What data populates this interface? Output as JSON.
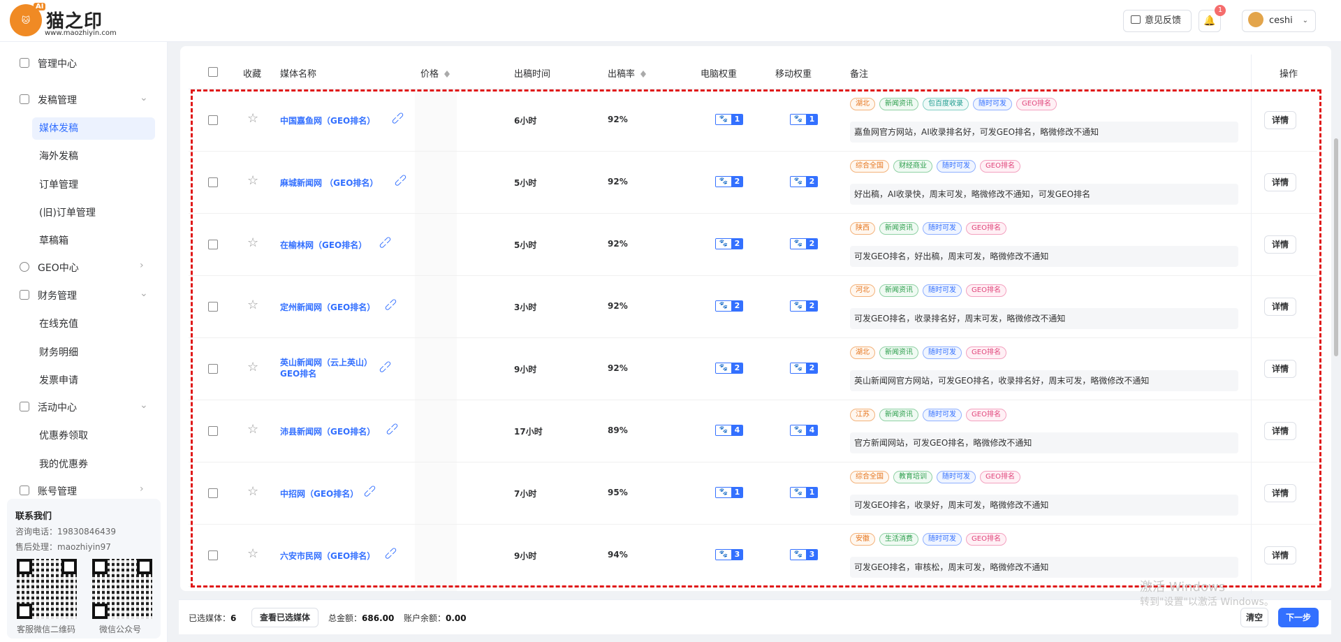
{
  "brand": {
    "title": "猫之印",
    "url": "www.maozhiyin.com",
    "badge_text": "AI"
  },
  "header": {
    "feedback_label": "意见反馈",
    "notification_count": "1",
    "username": "ceshi"
  },
  "sidebar": {
    "manage_center": "管理中心",
    "publish_manage": "发稿管理",
    "publish_items": [
      "媒体发稿",
      "海外发稿",
      "订单管理",
      "(旧)订单管理",
      "草稿箱"
    ],
    "geo_center": "GEO中心",
    "finance_manage": "财务管理",
    "finance_items": [
      "在线充值",
      "财务明细",
      "发票申请"
    ],
    "activity_center": "活动中心",
    "activity_items": [
      "优惠券领取",
      "我的优惠券"
    ],
    "account_manage": "账号管理",
    "contact": {
      "title": "联系我们",
      "phone": "咨询电话：19830846439",
      "aftersale": "售后处理：maozhiyin97",
      "qr1_caption": "客服微信二维码",
      "qr2_caption": "微信公众号"
    }
  },
  "table": {
    "headers": {
      "fav": "收藏",
      "name": "媒体名称",
      "price": "价格",
      "time": "出稿时间",
      "rate": "出稿率",
      "pc": "电脑权重",
      "mobile": "移动权重",
      "note": "备注",
      "op": "操作"
    },
    "detail_label": "详情",
    "rows": [
      {
        "name": "中国嘉鱼网（GEO排名）",
        "time": "6小时",
        "rate": "92%",
        "pc": "1",
        "mobile": "1",
        "tags": [
          "湖北",
          "新闻资讯",
          "包百度收录",
          "随时可发",
          "GEO排名"
        ],
        "note": "嘉鱼网官方网站，AI收录排名好，可发GEO排名，略微修改不通知"
      },
      {
        "name": "麻城新闻网 （GEO排名）",
        "time": "5小时",
        "rate": "92%",
        "pc": "2",
        "mobile": "2",
        "tags": [
          "综合全国",
          "财经商业",
          "随时可发",
          "GEO排名"
        ],
        "note": "好出稿，AI收录快，周末可发，略微修改不通知，可发GEO排名"
      },
      {
        "name": "在榆林网（GEO排名）",
        "time": "5小时",
        "rate": "92%",
        "pc": "2",
        "mobile": "2",
        "tags": [
          "陕西",
          "新闻资讯",
          "随时可发",
          "GEO排名"
        ],
        "note": "可发GEO排名，好出稿，周末可发，略微修改不通知"
      },
      {
        "name": "定州新闻网（GEO排名）",
        "time": "3小时",
        "rate": "92%",
        "pc": "2",
        "mobile": "2",
        "tags": [
          "河北",
          "新闻资讯",
          "随时可发",
          "GEO排名"
        ],
        "note": "可发GEO排名，收录排名好，周末可发，略微修改不通知"
      },
      {
        "name": "英山新闻网（云上英山）GEO排名",
        "time": "9小时",
        "rate": "92%",
        "pc": "2",
        "mobile": "2",
        "tags": [
          "湖北",
          "新闻资讯",
          "随时可发",
          "GEO排名"
        ],
        "note": "英山新闻网官方网站，可发GEO排名，收录排名好，周末可发，略微修改不通知"
      },
      {
        "name": "沛县新闻网（GEO排名）",
        "time": "17小时",
        "rate": "89%",
        "pc": "4",
        "mobile": "4",
        "tags": [
          "江苏",
          "新闻资讯",
          "随时可发",
          "GEO排名"
        ],
        "note": "官方新闻网站，可发GEO排名，略微修改不通知"
      },
      {
        "name": "中招网（GEO排名）",
        "time": "7小时",
        "rate": "95%",
        "pc": "1",
        "mobile": "1",
        "tags": [
          "综合全国",
          "教育培训",
          "随时可发",
          "GEO排名"
        ],
        "note": "可发GEO排名，收录好，周末可发，略微修改不通知"
      },
      {
        "name": "六安市民网（GEO排名）",
        "time": "9小时",
        "rate": "94%",
        "pc": "3",
        "mobile": "3",
        "tags": [
          "安徽",
          "生活消费",
          "随时可发",
          "GEO排名"
        ],
        "note": "可发GEO排名，审核松，周末可发，略微修改不通知"
      }
    ]
  },
  "footer": {
    "selected_label": "已选媒体：",
    "selected_count": "6",
    "view_selected": "查看已选媒体",
    "total_label": "总金额：",
    "total_value": "686.00",
    "balance_label": "账户余额：",
    "balance_value": "0.00",
    "clear_label": "清空",
    "next_label": "下一步"
  },
  "watermark": {
    "line1": "激活 Windows",
    "line2": "转到\"设置\"以激活 Windows。"
  },
  "colors": {
    "accent": "#3370ff",
    "highlight_border": "#e01818"
  }
}
